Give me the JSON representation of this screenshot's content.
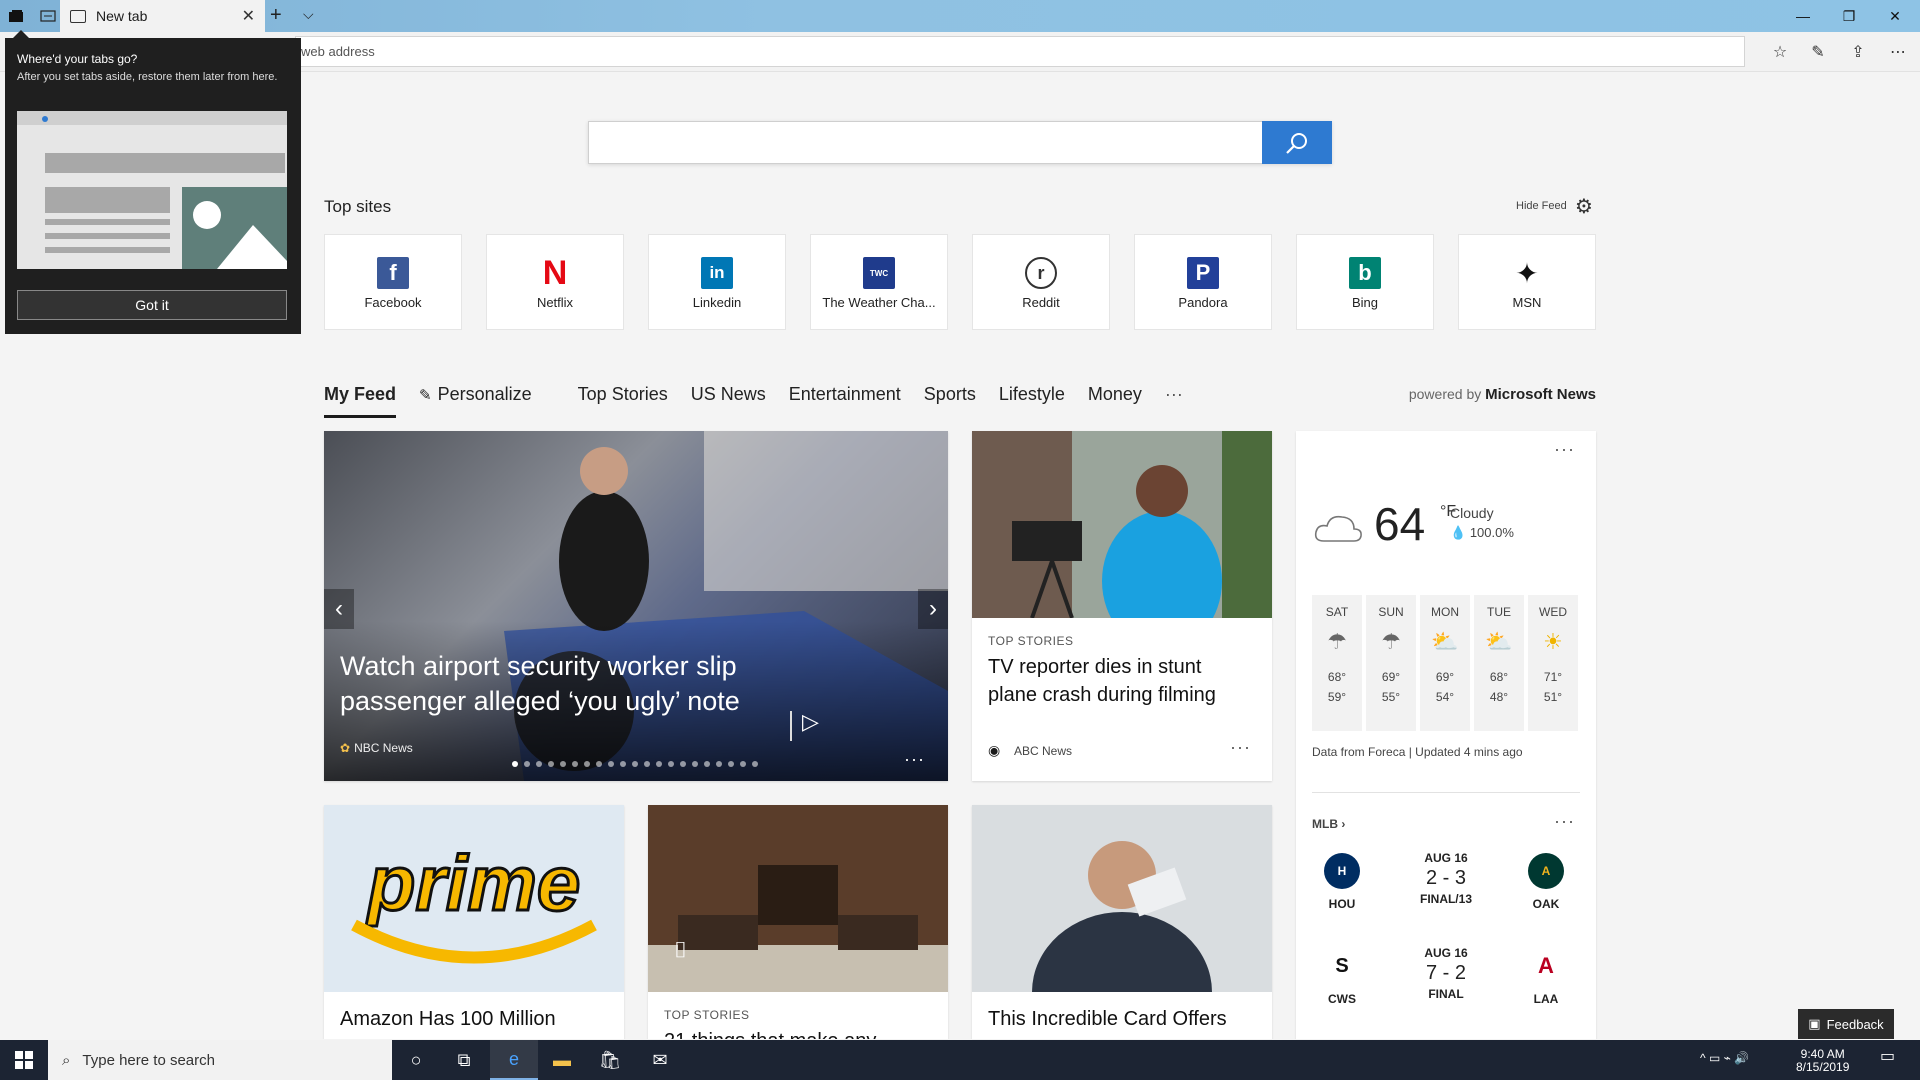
{
  "browser": {
    "tab_title": "New tab",
    "address_placeholder": "web address"
  },
  "popup": {
    "title": "Where'd your tabs go?",
    "body": "After you set tabs aside, restore them later from here.",
    "button": "Got it"
  },
  "top_sites": {
    "title": "Top sites",
    "hide_feed": "Hide Feed",
    "items": [
      {
        "name": "Facebook",
        "logo": "f",
        "color": "#3b5998"
      },
      {
        "name": "Netflix",
        "logo": "N",
        "color": "#ffffff"
      },
      {
        "name": "Linkedin",
        "logo": "in",
        "color": "#0077b5"
      },
      {
        "name": "The Weather Cha...",
        "logo": "TWC",
        "color": "#1f3b8c"
      },
      {
        "name": "Reddit",
        "logo": "r",
        "color": "#ffffff"
      },
      {
        "name": "Pandora",
        "logo": "P",
        "color": "#224099"
      },
      {
        "name": "Bing",
        "logo": "b",
        "color": "#008373"
      },
      {
        "name": "MSN",
        "logo": "✦",
        "color": "#ffffff"
      }
    ]
  },
  "feed_nav": {
    "items": [
      "My Feed",
      "Personalize",
      "Top Stories",
      "US News",
      "Entertainment",
      "Sports",
      "Lifestyle",
      "Money",
      "···"
    ],
    "powered_prefix": "powered by",
    "powered_brand": "Microsoft News"
  },
  "hero": {
    "title": "Watch airport security worker slip passenger alleged ‘you ugly’ note",
    "source": "NBC News",
    "more": "···"
  },
  "card_tv": {
    "kicker": "TOP STORIES",
    "title": "TV reporter dies in stunt plane crash during filming",
    "source": "ABC News",
    "more": "···"
  },
  "card_prime": {
    "title": "Amazon Has 100 Million"
  },
  "card_room": {
    "kicker": "TOP STORIES",
    "title": "21 things that make any"
  },
  "card_credit": {
    "title": "This Incredible Card Offers"
  },
  "weather": {
    "temp": "64",
    "unit": "°F",
    "condition": "Cloudy",
    "precip": "100.0%",
    "more": "···",
    "days": [
      {
        "name": "SAT",
        "hi": "68°",
        "lo": "59°",
        "icon": "☂"
      },
      {
        "name": "SUN",
        "hi": "69°",
        "lo": "55°",
        "icon": "☂"
      },
      {
        "name": "MON",
        "hi": "69°",
        "lo": "54°",
        "icon": "⛅"
      },
      {
        "name": "TUE",
        "hi": "68°",
        "lo": "48°",
        "icon": "⛅"
      },
      {
        "name": "WED",
        "hi": "71°",
        "lo": "51°",
        "icon": "☀"
      }
    ],
    "footer": "Data from Foreca | Updated 4 mins ago"
  },
  "mlb": {
    "label": "MLB",
    "more": "···",
    "games": [
      {
        "home": "HOU",
        "away": "OAK",
        "date": "AUG 16",
        "score": "2 - 3",
        "status": "FINAL/13",
        "home_color": "#002d62",
        "away_color": "#003831"
      },
      {
        "home": "CWS",
        "away": "LAA",
        "date": "AUG 16",
        "score": "7 - 2",
        "status": "FINAL",
        "home_color": "#111111",
        "away_color": "#ba0021"
      }
    ]
  },
  "feedback": "Feedback",
  "taskbar": {
    "search_placeholder": "Type here to search",
    "time": "9:40 AM",
    "date": "8/15/2019"
  }
}
